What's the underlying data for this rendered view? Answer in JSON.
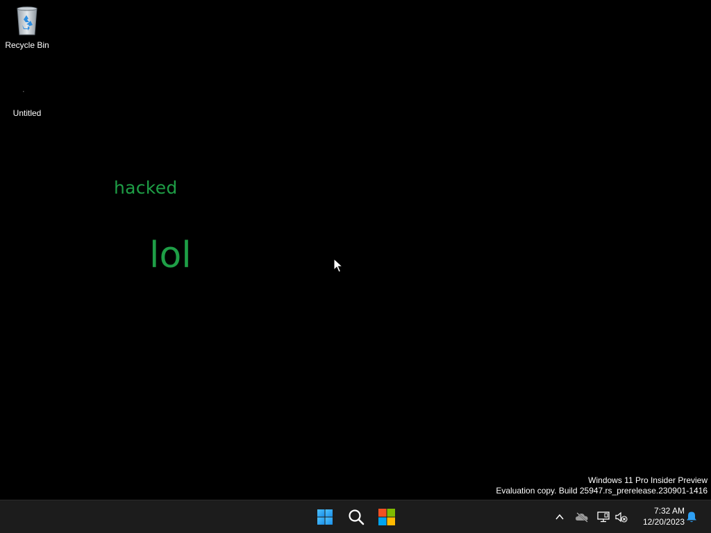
{
  "desktop": {
    "icons": [
      {
        "label": "Recycle Bin",
        "icon": "recycle-bin-icon"
      },
      {
        "label": "Untitled",
        "icon": "blank-file-icon"
      }
    ],
    "wallpaper_text": {
      "line1": "hacked",
      "line2": "lol",
      "color": "#1e9e46"
    },
    "background_color": "#000000"
  },
  "watermark": {
    "line1": "Windows 11 Pro Insider Preview",
    "line2": "Evaluation copy. Build 25947.rs_prerelease.230901-1416"
  },
  "taskbar": {
    "background_color": "#1c1c1c",
    "pinned": [
      {
        "name": "start",
        "icon": "windows-logo-icon"
      },
      {
        "name": "search",
        "icon": "search-icon"
      },
      {
        "name": "store",
        "icon": "microsoft-store-icon"
      }
    ],
    "tray": {
      "icons": [
        "chevron-up-icon",
        "onedrive-icon",
        "network-icon",
        "volume-muted-icon",
        "notification-bell-icon"
      ],
      "time": "7:32 AM",
      "date": "12/20/2023"
    }
  }
}
